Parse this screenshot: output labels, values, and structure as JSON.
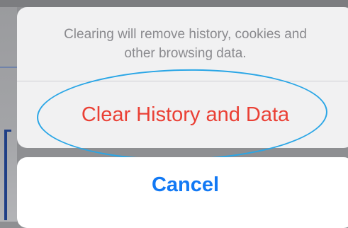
{
  "action_sheet": {
    "message": "Clearing will remove history, cookies and\nother browsing data.",
    "destructive_action_label": "Clear History and Data",
    "cancel_label": "Cancel"
  },
  "colors": {
    "destructive": "#ea4035",
    "cancel": "#1279f4",
    "message_text": "#8a8a8e",
    "highlight_annotation": "#2aa6e6"
  }
}
